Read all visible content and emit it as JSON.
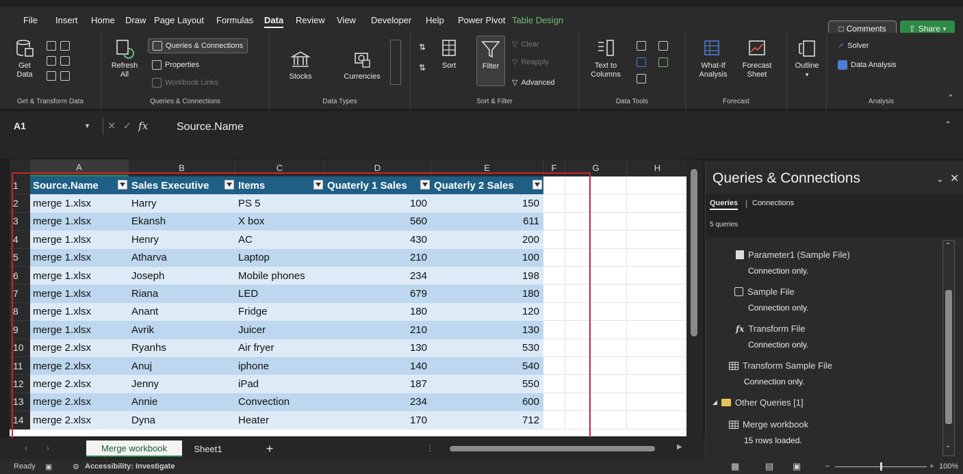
{
  "menu": {
    "items": [
      "File",
      "Insert",
      "Home",
      "Draw",
      "Page Layout",
      "Formulas",
      "Data",
      "Review",
      "View",
      "Developer",
      "Help",
      "Power Pivot",
      "Table Design"
    ],
    "active": "Data",
    "comments_label": "Comments",
    "share_label": "Share"
  },
  "ribbon": {
    "get_transform": {
      "get_data": "Get\nData",
      "label": "Get & Transform Data"
    },
    "queries": {
      "refresh": "Refresh\nAll",
      "queries_connections": "Queries & Connections",
      "properties": "Properties",
      "workbook_links": "Workbook Links",
      "label": "Queries & Connections"
    },
    "data_types": {
      "stocks": "Stocks",
      "currencies": "Currencies",
      "label": "Data Types"
    },
    "sort_filter": {
      "sort": "Sort",
      "filter": "Filter",
      "clear": "Clear",
      "reapply": "Reapply",
      "advanced": "Advanced",
      "label": "Sort & Filter"
    },
    "data_tools": {
      "text_to_columns": "Text to\nColumns",
      "label": "Data Tools"
    },
    "forecast": {
      "what_if": "What-If\nAnalysis",
      "forecast_sheet": "Forecast\nSheet",
      "label": "Forecast"
    },
    "outline": {
      "label": "Outline"
    },
    "analysis": {
      "solver": "Solver",
      "data_analysis": "Data Analysis",
      "label": "Analysis"
    }
  },
  "formula_bar": {
    "name_box": "A1",
    "content": "Source.Name"
  },
  "grid": {
    "columns": [
      "A",
      "B",
      "C",
      "D",
      "E",
      "F",
      "G",
      "H"
    ],
    "headers": [
      "Source.Name",
      "Sales Executive",
      "Items",
      "Quaterly 1 Sales",
      "Quaterly 2 Sales"
    ],
    "rows": [
      [
        "merge 1.xlsx",
        "Harry",
        "PS 5",
        "100",
        "150"
      ],
      [
        "merge 1.xlsx",
        "Ekansh",
        "X box",
        "560",
        "611"
      ],
      [
        "merge 1.xlsx",
        "Henry",
        "AC",
        "430",
        "200"
      ],
      [
        "merge 1.xlsx",
        "Atharva",
        "Laptop",
        "210",
        "100"
      ],
      [
        "merge 1.xlsx",
        "Joseph",
        "Mobile phones",
        "234",
        "198"
      ],
      [
        "merge 1.xlsx",
        "Riana",
        "LED",
        "679",
        "180"
      ],
      [
        "merge 1.xlsx",
        "Anant",
        "Fridge",
        "180",
        "120"
      ],
      [
        "merge 1.xlsx",
        "Avrik",
        "Juicer",
        "210",
        "130"
      ],
      [
        "merge 2.xlsx",
        "Ryanhs",
        "Air fryer",
        "130",
        "530"
      ],
      [
        "merge 2.xlsx",
        "Anuj",
        "iphone",
        "140",
        "540"
      ],
      [
        "merge 2.xlsx",
        "Jenny",
        "iPad",
        "187",
        "550"
      ],
      [
        "merge 2.xlsx",
        "Annie",
        "Convection",
        "234",
        "600"
      ],
      [
        "merge 2.xlsx",
        "Dyna",
        "Heater",
        "170",
        "712"
      ]
    ],
    "row_numbers": [
      "1",
      "2",
      "3",
      "4",
      "5",
      "6",
      "7",
      "8",
      "9",
      "10",
      "11",
      "12",
      "13",
      "14"
    ]
  },
  "sheets": {
    "tabs": [
      "Merge workbook",
      "Sheet1"
    ],
    "active": "Merge workbook",
    "add": "+"
  },
  "status": {
    "ready": "Ready",
    "accessibility": "Accessibility: Investigate",
    "zoom": "100%"
  },
  "queries_pane": {
    "title": "Queries & Connections",
    "tabs": [
      "Queries",
      "Connections"
    ],
    "count": "5 queries",
    "items": [
      {
        "name": "Parameter1 (Sample File)",
        "sub": "Connection only.",
        "icon": "parameter-icon"
      },
      {
        "name": "Sample File",
        "sub": "Connection only.",
        "icon": "query-icon"
      },
      {
        "name": "Transform File",
        "sub": "Connection only.",
        "icon": "function-icon"
      },
      {
        "name": "Transform Sample File",
        "sub": "Connection only.",
        "icon": "table-icon"
      }
    ],
    "group": "Other Queries [1]",
    "group_item": {
      "name": "Merge workbook",
      "sub": "15 rows loaded.",
      "icon": "table-icon"
    }
  },
  "colors": {
    "header_fill": "#1f5f86",
    "band_light": "#ddebf7",
    "band_dark": "#bdd7ee",
    "highlight_border": "#c8262e",
    "share_green": "#2f8a46"
  }
}
